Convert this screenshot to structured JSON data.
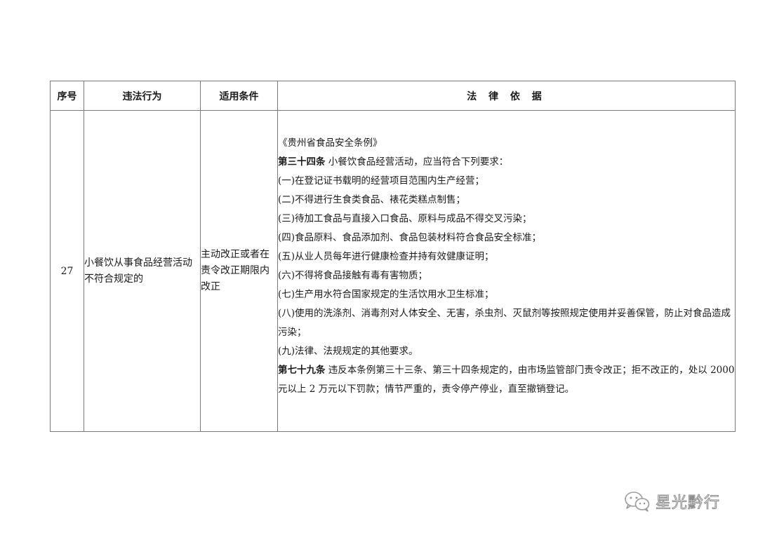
{
  "table": {
    "headers": {
      "seq": "序号",
      "act": "违法行为",
      "cond": "适用条件",
      "basis": "法 律 依 据"
    },
    "rows": [
      {
        "seq": "27",
        "act": "小餐饮从事食品经营活动不符合规定的",
        "cond": "主动改正或者在责令改正期限内改正",
        "basis": {
          "source": "《贵州省食品安全条例》",
          "art34_title": "第三十四条",
          "art34_text": " 小餐饮食品经营活动，应当符合下列要求：",
          "items": [
            "(一)在登记证书载明的经营项目范围内生产经营；",
            "(二)不得进行生食类食品、裱花类糕点制售；",
            "(三)待加工食品与直接入口食品、原料与成品不得交叉污染；",
            "(四)食品原料、食品添加剂、食品包装材料符合食品安全标准；",
            "(五)从业人员每年进行健康检查并持有效健康证明；",
            "(六)不得将食品接触有毒有害物质；",
            "(七)生产用水符合国家规定的生活饮用水卫生标准；",
            "(八)使用的洗涤剂、消毒剂对人体安全、无害，杀虫剂、灭鼠剂等按照规定使用并妥善保管，防止对食品造成污染；",
            "(九)法律、法规规定的其他要求。"
          ],
          "art79_title": "第七十九条",
          "art79_text": " 违反本条例第三十三条、第三十四条规定的，由市场监管部门责令改正；拒不改正的，处以 2000 元以上 2 万元以下罚款；情节严重的，责令停产停业，直至撤销登记。"
        }
      }
    ]
  },
  "watermark": {
    "text": "星光黔行",
    "icon": "wechat-icon"
  }
}
